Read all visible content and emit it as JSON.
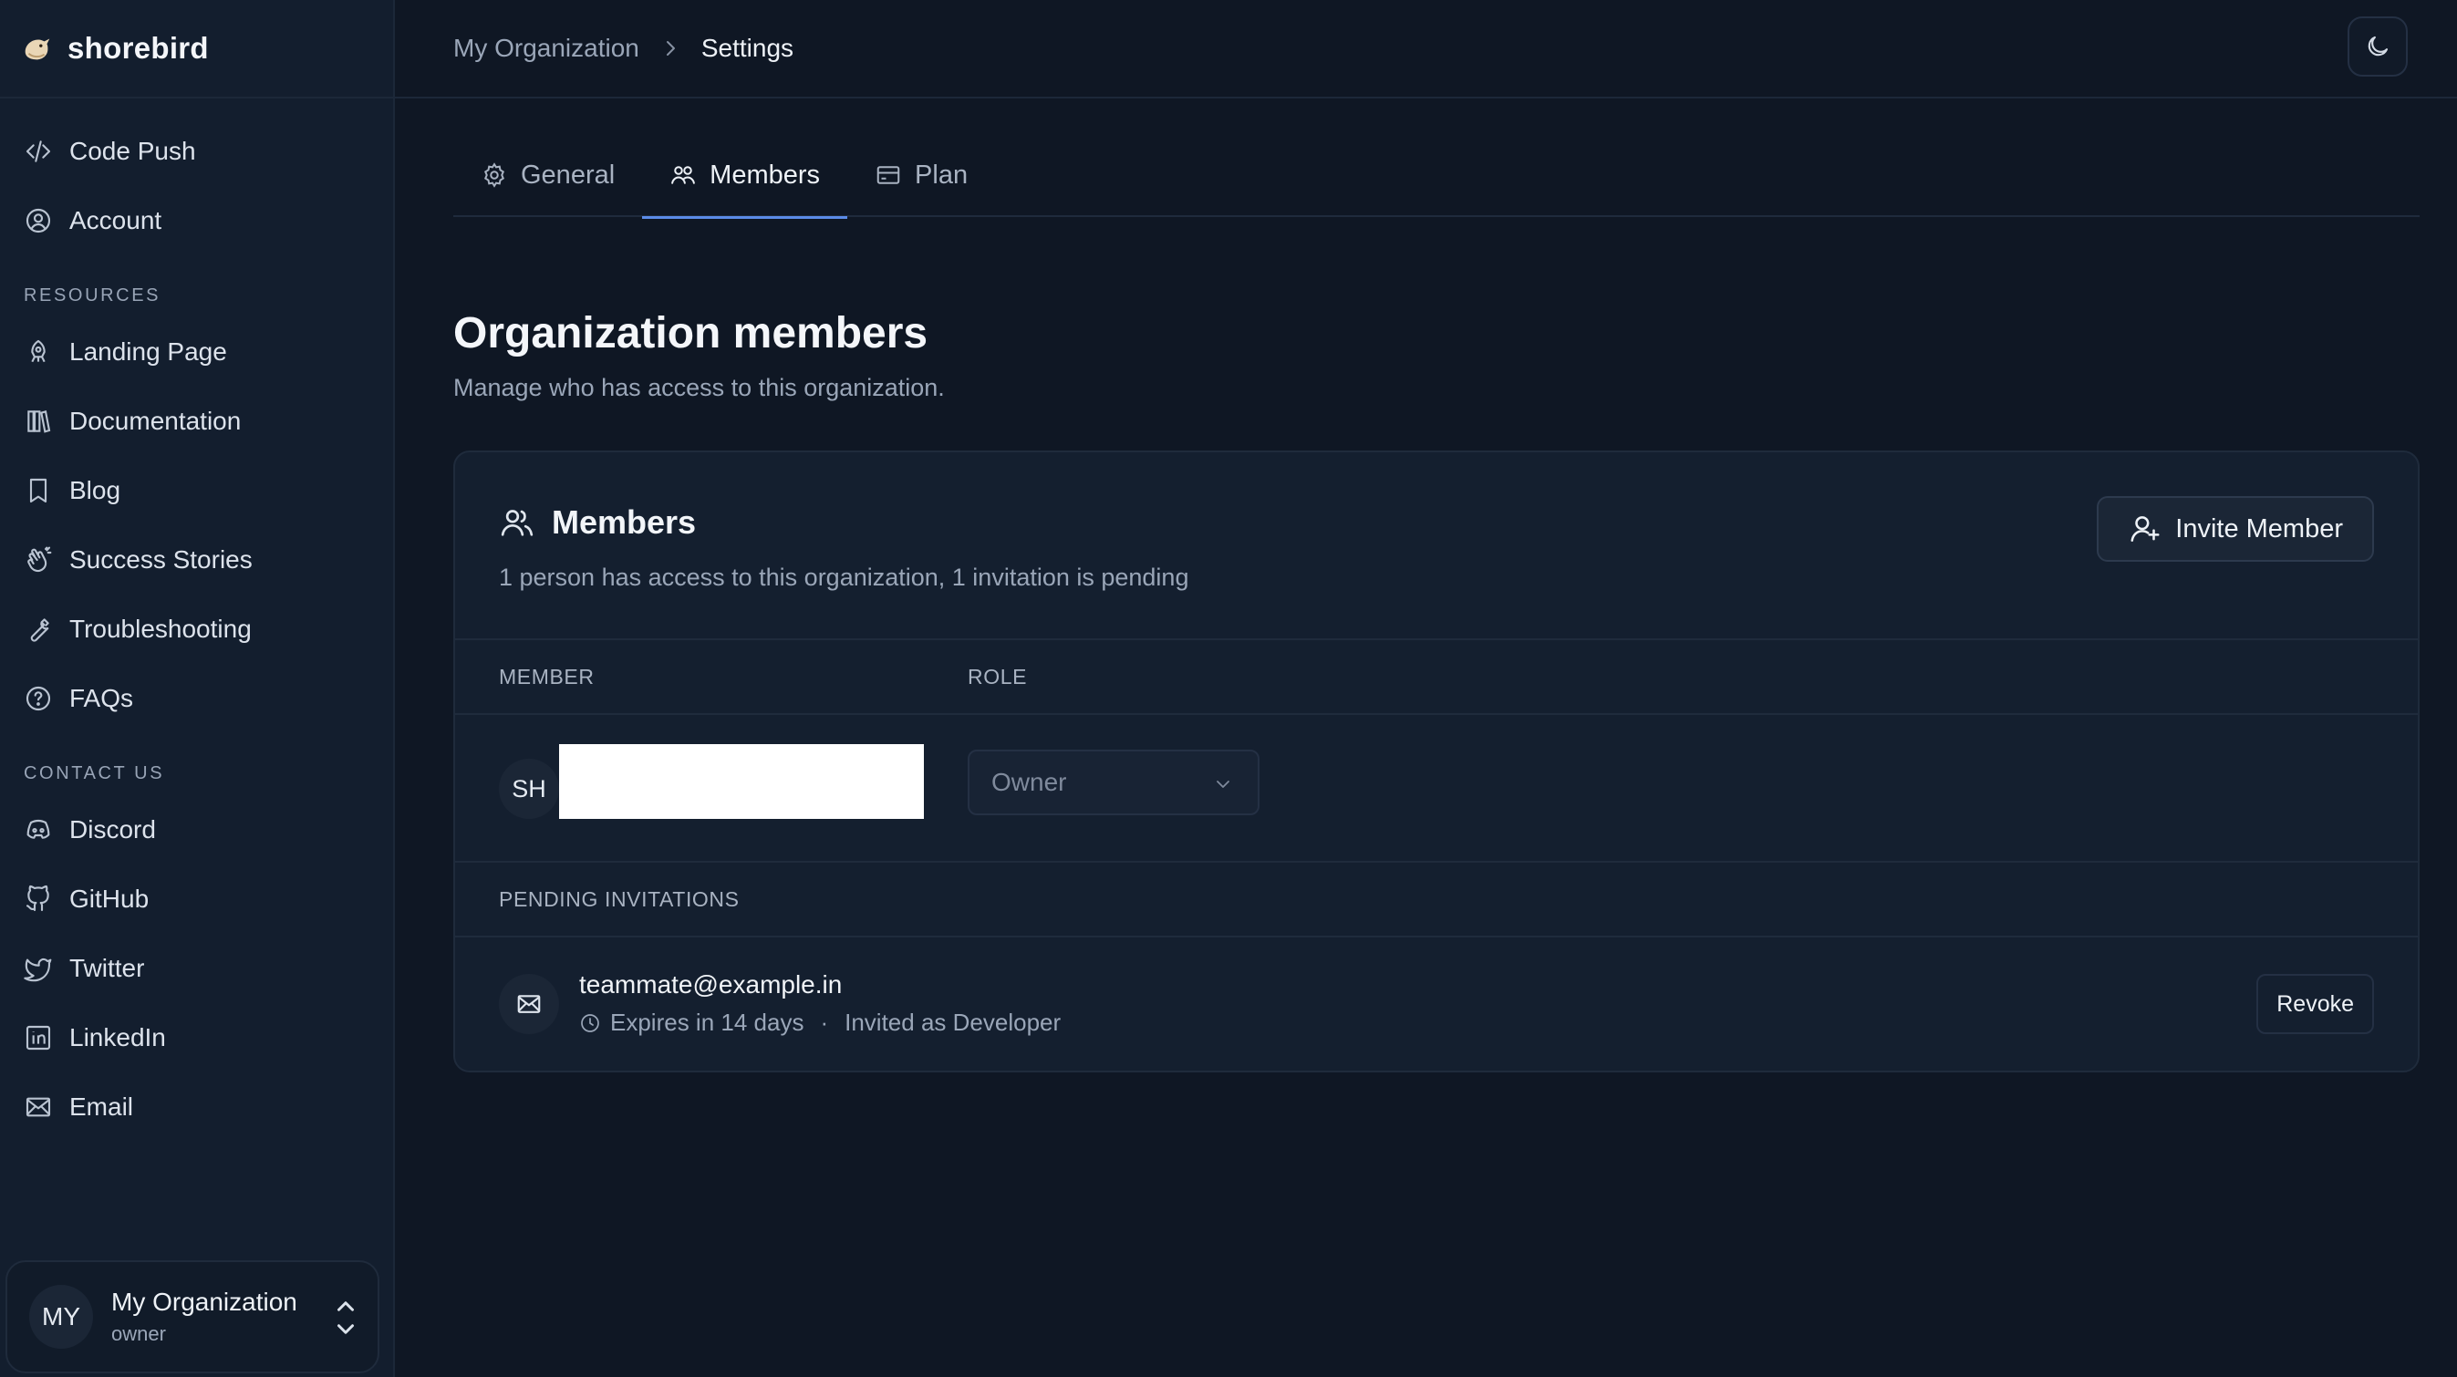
{
  "brand": {
    "name": "shorebird"
  },
  "sidebar": {
    "main_items": [
      {
        "label": "Code Push",
        "icon": "code-icon"
      },
      {
        "label": "Account",
        "icon": "account-icon"
      }
    ],
    "resources_label": "RESOURCES",
    "resources": [
      {
        "label": "Landing Page",
        "icon": "rocket-icon"
      },
      {
        "label": "Documentation",
        "icon": "library-icon"
      },
      {
        "label": "Blog",
        "icon": "bookmark-icon"
      },
      {
        "label": "Success Stories",
        "icon": "clap-icon"
      },
      {
        "label": "Troubleshooting",
        "icon": "wrench-icon"
      },
      {
        "label": "FAQs",
        "icon": "help-circle-icon"
      }
    ],
    "contact_label": "CONTACT US",
    "contact": [
      {
        "label": "Discord",
        "icon": "discord-icon"
      },
      {
        "label": "GitHub",
        "icon": "github-icon"
      },
      {
        "label": "Twitter",
        "icon": "twitter-icon"
      },
      {
        "label": "LinkedIn",
        "icon": "linkedin-icon"
      },
      {
        "label": "Email",
        "icon": "mail-icon"
      }
    ],
    "org": {
      "initials": "MY",
      "name": "My Organization",
      "role": "owner"
    }
  },
  "breadcrumb": {
    "parent": "My Organization",
    "current": "Settings"
  },
  "tabs": [
    {
      "label": "General",
      "icon": "gear-icon"
    },
    {
      "label": "Members",
      "icon": "users-icon",
      "active": true
    },
    {
      "label": "Plan",
      "icon": "credit-card-icon"
    }
  ],
  "page": {
    "title": "Organization members",
    "subtitle": "Manage who has access to this organization."
  },
  "members_card": {
    "title": "Members",
    "description": "1 person has access to this organization, 1 invitation is pending",
    "invite_label": "Invite Member",
    "columns": {
      "member": "MEMBER",
      "role": "ROLE"
    },
    "members": [
      {
        "initials": "SH",
        "role": "Owner"
      }
    ],
    "pending_label": "PENDING INVITATIONS",
    "invitations": [
      {
        "email": "teammate@example.in",
        "expires": "Expires in 14 days",
        "separator": "·",
        "invited_as": "Invited as Developer",
        "revoke_label": "Revoke"
      }
    ]
  }
}
